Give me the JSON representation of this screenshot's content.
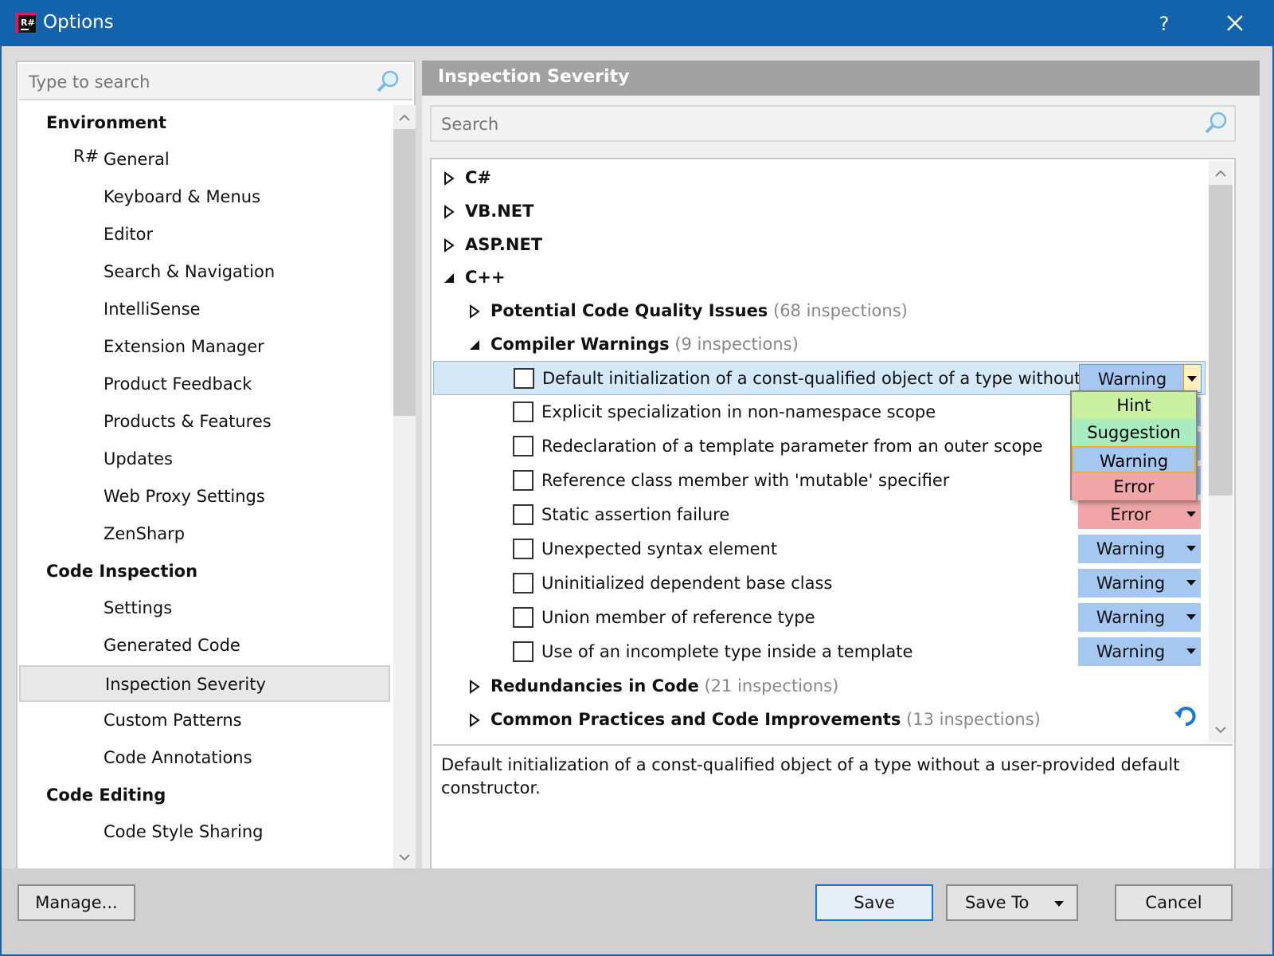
{
  "window": {
    "title": "Options",
    "help_label": "?"
  },
  "left": {
    "search_placeholder": "Type to search",
    "tree": [
      {
        "type": "cat",
        "label": "Environment"
      },
      {
        "type": "item",
        "label": "General",
        "icon": "resharper-icon"
      },
      {
        "type": "item",
        "label": "Keyboard & Menus",
        "icon": "keyboard-icon"
      },
      {
        "type": "item",
        "label": "Editor",
        "icon": "pencil-icon",
        "expander": true
      },
      {
        "type": "item",
        "label": "Search & Navigation",
        "icon": "magnifier-icon"
      },
      {
        "type": "item",
        "label": "IntelliSense",
        "icon": "lightbulb-icon",
        "expander": true
      },
      {
        "type": "item",
        "label": "Extension Manager",
        "icon": "extension-icon"
      },
      {
        "type": "item",
        "label": "Product Feedback",
        "icon": "envelope-icon"
      },
      {
        "type": "item",
        "label": "Products & Features",
        "icon": "grid-icon"
      },
      {
        "type": "item",
        "label": "Updates",
        "icon": "download-icon"
      },
      {
        "type": "item",
        "label": "Web Proxy Settings",
        "icon": "globe-plug-icon"
      },
      {
        "type": "item",
        "label": "ZenSharp",
        "icon": "zensharp-icon"
      },
      {
        "type": "cat",
        "label": "Code Inspection"
      },
      {
        "type": "item",
        "label": "Settings",
        "icon": "person-icon"
      },
      {
        "type": "item",
        "label": "Generated Code",
        "icon": "generated-code-icon"
      },
      {
        "type": "item",
        "label": "Inspection Severity",
        "icon": "severity-icon",
        "selected": true
      },
      {
        "type": "item",
        "label": "Custom Patterns",
        "icon": "patterns-icon"
      },
      {
        "type": "item",
        "label": "Code Annotations",
        "icon": "annotations-icon"
      },
      {
        "type": "cat",
        "label": "Code Editing"
      },
      {
        "type": "item",
        "label": "Code Style Sharing",
        "icon": "sharing-icon"
      }
    ]
  },
  "right": {
    "title": "Inspection Severity",
    "search_placeholder": "Search",
    "languages": [
      "C#",
      "VB.NET",
      "ASP.NET",
      "C++"
    ],
    "groups": {
      "potential": {
        "label": "Potential Code Quality Issues",
        "count": "(68 inspections)"
      },
      "compiler": {
        "label": "Compiler Warnings",
        "count": "(9 inspections)"
      },
      "redundancies": {
        "label": "Redundancies in Code",
        "count": "(21 inspections)"
      },
      "common": {
        "label": "Common Practices and Code Improvements",
        "count": "(13 inspections)"
      }
    },
    "inspections": [
      {
        "label": "Default initialization of a const-qualified object of a type without...",
        "severity": "Warning"
      },
      {
        "label": "Explicit specialization in non-namespace scope",
        "severity": "Warning"
      },
      {
        "label": "Redeclaration of a template parameter from an outer scope",
        "severity": "Warning"
      },
      {
        "label": "Reference class member with 'mutable' specifier",
        "severity": "Warning"
      },
      {
        "label": "Static assertion failure",
        "severity": "Error"
      },
      {
        "label": "Unexpected syntax element",
        "severity": "Warning"
      },
      {
        "label": "Uninitialized dependent base class",
        "severity": "Warning"
      },
      {
        "label": "Union member of reference type",
        "severity": "Warning"
      },
      {
        "label": "Use of an incomplete type inside a template",
        "severity": "Warning"
      }
    ],
    "popup_options": [
      "Hint",
      "Suggestion",
      "Warning",
      "Error"
    ],
    "description": "Default initialization of a const-qualified object of a type without a user-provided default constructor."
  },
  "colors": {
    "hint": "#c8f0a0",
    "suggestion": "#a8ecc0",
    "warning": "#a6c8f0",
    "error": "#f0a6a6",
    "accent": "#1262ac"
  },
  "buttons": {
    "manage": "Manage...",
    "save": "Save",
    "save_to": "Save To",
    "cancel": "Cancel"
  }
}
